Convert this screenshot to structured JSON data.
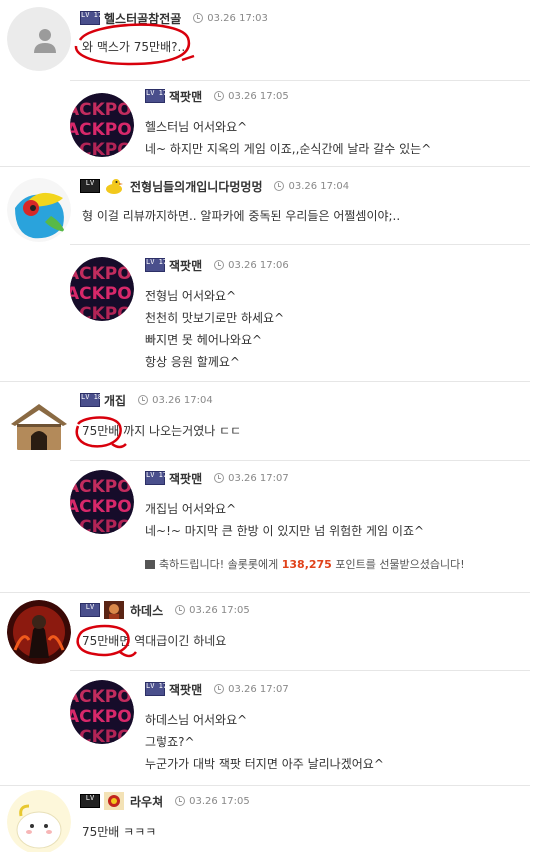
{
  "comments": [
    {
      "nick": "헬스터골참전골",
      "lvl": "LV 173",
      "time": "03.26 17:03",
      "lines": [
        "와 맥스가 75만배?.."
      ]
    },
    {
      "nick": "잭팟맨",
      "lvl": "LV 179",
      "time": "03.26 17:05",
      "lines": [
        "헬스터님 어서와요^",
        "네~ 하지만 지옥의 게임 이죠,,순식간에 날라 갈수 있는^"
      ]
    },
    {
      "nick": "전형님들의개입니다멍멍멍",
      "lvl": "LV",
      "time": "03.26 17:04",
      "lines": [
        "형 이걸 리뷰까지하면.. 알파카에 중독된 우리들은 어쩔셈이야;.."
      ]
    },
    {
      "nick": "잭팟맨",
      "lvl": "LV 179",
      "time": "03.26 17:06",
      "lines": [
        "전형님 어서와요^",
        "천천히 맛보기로만 하세요^",
        "빠지면 못 헤어나와요^",
        "항상 응원 할께요^"
      ]
    },
    {
      "nick": "개집",
      "lvl": "LV 182",
      "time": "03.26 17:04",
      "lines": [
        "75만배 까지  나오는거였나 ㄷㄷ"
      ]
    },
    {
      "nick": "잭팟맨",
      "lvl": "LV 179",
      "time": "03.26 17:07",
      "lines": [
        "개집님 어서와요^",
        "네~!~ 마지막 큰 한방 이 있지만 넘 위험한 게임 이죠^"
      ],
      "gift": {
        "prefix": "축하드립니다! 솔롯롯에게 ",
        "points": "138,275",
        "suffix": " 포인트를 선물받으셨습니다!"
      }
    },
    {
      "nick": "하데스",
      "lvl": "LV",
      "time": "03.26 17:05",
      "lines": [
        "75만배면 역대급이긴 하네요"
      ]
    },
    {
      "nick": "잭팟맨",
      "lvl": "LV 179",
      "time": "03.26 17:07",
      "lines": [
        "하데스님 어서와요^",
        "그렇죠?^",
        "누군가가 대박 잭팟 터지면 아주 날리나겠어요^"
      ]
    },
    {
      "nick": "라우쳐",
      "lvl": "LV",
      "time": "03.26 17:05",
      "lines": [
        "75만배 ㅋㅋㅋ"
      ]
    }
  ],
  "colors": {
    "accent": "#e0421a",
    "scribble": "#d8000c",
    "level_badge": "#4a4f8c"
  }
}
